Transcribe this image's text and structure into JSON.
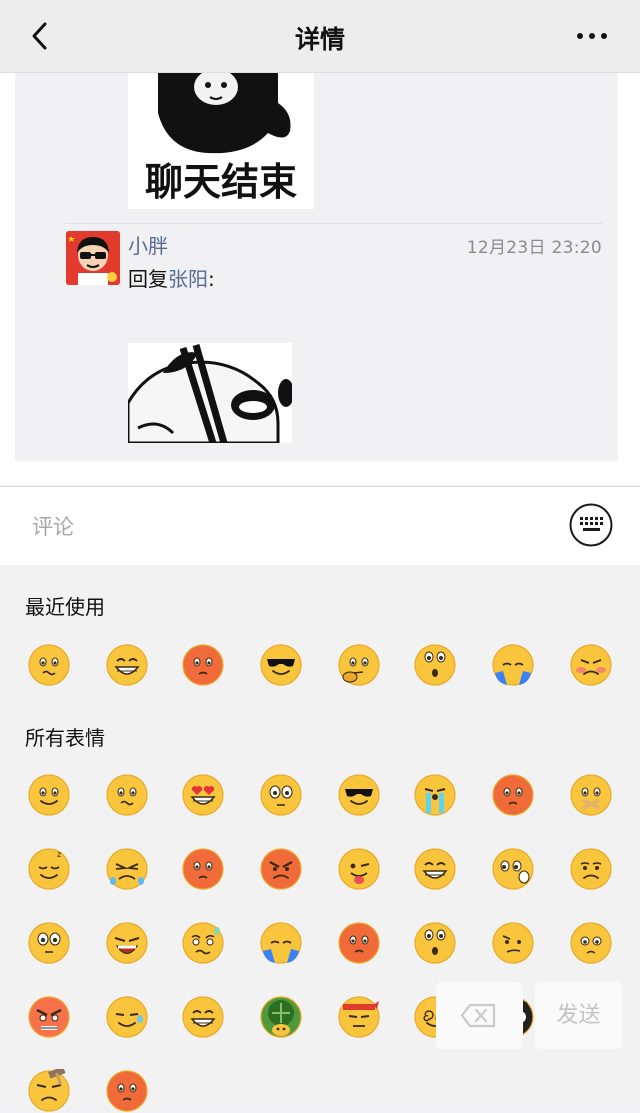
{
  "nav": {
    "title": "详情"
  },
  "sticker_top": {
    "caption": "聊天结束"
  },
  "comment": {
    "author": "小胖",
    "time": "12月23日 23:20",
    "reply_prefix": "回复",
    "reply_to": "张阳",
    "reply_suffix": ":"
  },
  "input": {
    "placeholder": "评论"
  },
  "emoji_panel": {
    "recent_title": "最近使用",
    "all_title": "所有表情",
    "recent": [
      "dizzy-face",
      "grin",
      "blush-red",
      "sunglasses",
      "thinking",
      "surprised",
      "facepalm",
      "angry-blush"
    ],
    "all": [
      "smile",
      "dizzy-face",
      "heart-eyes",
      "wide-eyes",
      "sunglasses",
      "crying",
      "blush-red",
      "shut-mouth",
      "sleepy",
      "sob",
      "blush-red",
      "angry",
      "tongue",
      "grin",
      "surprised-left",
      "frown",
      "shocked",
      "yawn",
      "sweat-worry",
      "facepalm",
      "blush-red",
      "surprised",
      "confused",
      "sad-eyes",
      "angry-red",
      "squint-sweat",
      "grin",
      "turtle",
      "headband",
      "spiral-eyes",
      "owl",
      "skull",
      "hammer",
      "blush-red"
    ],
    "send_label": "发送"
  },
  "colors": {
    "link": "#576b95",
    "emoji_yellow": "#f9c53c"
  }
}
